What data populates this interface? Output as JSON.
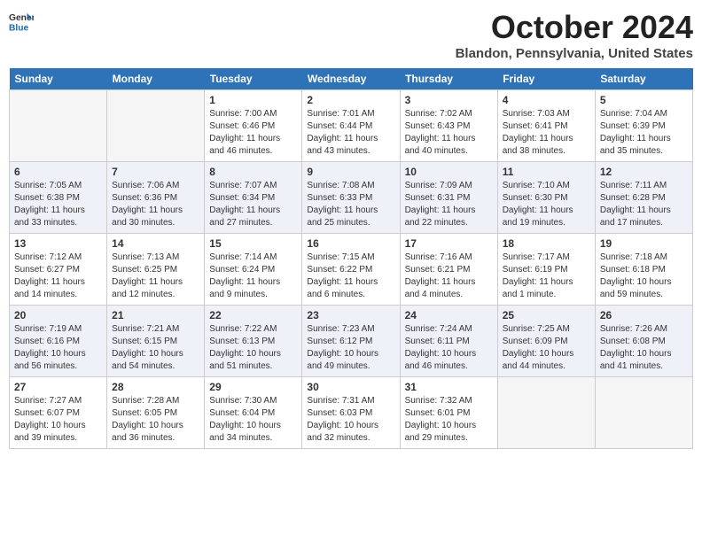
{
  "logo": {
    "general": "General",
    "blue": "Blue"
  },
  "title": "October 2024",
  "location": "Blandon, Pennsylvania, United States",
  "headers": [
    "Sunday",
    "Monday",
    "Tuesday",
    "Wednesday",
    "Thursday",
    "Friday",
    "Saturday"
  ],
  "weeks": [
    [
      {
        "day": "",
        "sunrise": "",
        "sunset": "",
        "daylight": ""
      },
      {
        "day": "",
        "sunrise": "",
        "sunset": "",
        "daylight": ""
      },
      {
        "day": "1",
        "sunrise": "Sunrise: 7:00 AM",
        "sunset": "Sunset: 6:46 PM",
        "daylight": "Daylight: 11 hours and 46 minutes."
      },
      {
        "day": "2",
        "sunrise": "Sunrise: 7:01 AM",
        "sunset": "Sunset: 6:44 PM",
        "daylight": "Daylight: 11 hours and 43 minutes."
      },
      {
        "day": "3",
        "sunrise": "Sunrise: 7:02 AM",
        "sunset": "Sunset: 6:43 PM",
        "daylight": "Daylight: 11 hours and 40 minutes."
      },
      {
        "day": "4",
        "sunrise": "Sunrise: 7:03 AM",
        "sunset": "Sunset: 6:41 PM",
        "daylight": "Daylight: 11 hours and 38 minutes."
      },
      {
        "day": "5",
        "sunrise": "Sunrise: 7:04 AM",
        "sunset": "Sunset: 6:39 PM",
        "daylight": "Daylight: 11 hours and 35 minutes."
      }
    ],
    [
      {
        "day": "6",
        "sunrise": "Sunrise: 7:05 AM",
        "sunset": "Sunset: 6:38 PM",
        "daylight": "Daylight: 11 hours and 33 minutes."
      },
      {
        "day": "7",
        "sunrise": "Sunrise: 7:06 AM",
        "sunset": "Sunset: 6:36 PM",
        "daylight": "Daylight: 11 hours and 30 minutes."
      },
      {
        "day": "8",
        "sunrise": "Sunrise: 7:07 AM",
        "sunset": "Sunset: 6:34 PM",
        "daylight": "Daylight: 11 hours and 27 minutes."
      },
      {
        "day": "9",
        "sunrise": "Sunrise: 7:08 AM",
        "sunset": "Sunset: 6:33 PM",
        "daylight": "Daylight: 11 hours and 25 minutes."
      },
      {
        "day": "10",
        "sunrise": "Sunrise: 7:09 AM",
        "sunset": "Sunset: 6:31 PM",
        "daylight": "Daylight: 11 hours and 22 minutes."
      },
      {
        "day": "11",
        "sunrise": "Sunrise: 7:10 AM",
        "sunset": "Sunset: 6:30 PM",
        "daylight": "Daylight: 11 hours and 19 minutes."
      },
      {
        "day": "12",
        "sunrise": "Sunrise: 7:11 AM",
        "sunset": "Sunset: 6:28 PM",
        "daylight": "Daylight: 11 hours and 17 minutes."
      }
    ],
    [
      {
        "day": "13",
        "sunrise": "Sunrise: 7:12 AM",
        "sunset": "Sunset: 6:27 PM",
        "daylight": "Daylight: 11 hours and 14 minutes."
      },
      {
        "day": "14",
        "sunrise": "Sunrise: 7:13 AM",
        "sunset": "Sunset: 6:25 PM",
        "daylight": "Daylight: 11 hours and 12 minutes."
      },
      {
        "day": "15",
        "sunrise": "Sunrise: 7:14 AM",
        "sunset": "Sunset: 6:24 PM",
        "daylight": "Daylight: 11 hours and 9 minutes."
      },
      {
        "day": "16",
        "sunrise": "Sunrise: 7:15 AM",
        "sunset": "Sunset: 6:22 PM",
        "daylight": "Daylight: 11 hours and 6 minutes."
      },
      {
        "day": "17",
        "sunrise": "Sunrise: 7:16 AM",
        "sunset": "Sunset: 6:21 PM",
        "daylight": "Daylight: 11 hours and 4 minutes."
      },
      {
        "day": "18",
        "sunrise": "Sunrise: 7:17 AM",
        "sunset": "Sunset: 6:19 PM",
        "daylight": "Daylight: 11 hours and 1 minute."
      },
      {
        "day": "19",
        "sunrise": "Sunrise: 7:18 AM",
        "sunset": "Sunset: 6:18 PM",
        "daylight": "Daylight: 10 hours and 59 minutes."
      }
    ],
    [
      {
        "day": "20",
        "sunrise": "Sunrise: 7:19 AM",
        "sunset": "Sunset: 6:16 PM",
        "daylight": "Daylight: 10 hours and 56 minutes."
      },
      {
        "day": "21",
        "sunrise": "Sunrise: 7:21 AM",
        "sunset": "Sunset: 6:15 PM",
        "daylight": "Daylight: 10 hours and 54 minutes."
      },
      {
        "day": "22",
        "sunrise": "Sunrise: 7:22 AM",
        "sunset": "Sunset: 6:13 PM",
        "daylight": "Daylight: 10 hours and 51 minutes."
      },
      {
        "day": "23",
        "sunrise": "Sunrise: 7:23 AM",
        "sunset": "Sunset: 6:12 PM",
        "daylight": "Daylight: 10 hours and 49 minutes."
      },
      {
        "day": "24",
        "sunrise": "Sunrise: 7:24 AM",
        "sunset": "Sunset: 6:11 PM",
        "daylight": "Daylight: 10 hours and 46 minutes."
      },
      {
        "day": "25",
        "sunrise": "Sunrise: 7:25 AM",
        "sunset": "Sunset: 6:09 PM",
        "daylight": "Daylight: 10 hours and 44 minutes."
      },
      {
        "day": "26",
        "sunrise": "Sunrise: 7:26 AM",
        "sunset": "Sunset: 6:08 PM",
        "daylight": "Daylight: 10 hours and 41 minutes."
      }
    ],
    [
      {
        "day": "27",
        "sunrise": "Sunrise: 7:27 AM",
        "sunset": "Sunset: 6:07 PM",
        "daylight": "Daylight: 10 hours and 39 minutes."
      },
      {
        "day": "28",
        "sunrise": "Sunrise: 7:28 AM",
        "sunset": "Sunset: 6:05 PM",
        "daylight": "Daylight: 10 hours and 36 minutes."
      },
      {
        "day": "29",
        "sunrise": "Sunrise: 7:30 AM",
        "sunset": "Sunset: 6:04 PM",
        "daylight": "Daylight: 10 hours and 34 minutes."
      },
      {
        "day": "30",
        "sunrise": "Sunrise: 7:31 AM",
        "sunset": "Sunset: 6:03 PM",
        "daylight": "Daylight: 10 hours and 32 minutes."
      },
      {
        "day": "31",
        "sunrise": "Sunrise: 7:32 AM",
        "sunset": "Sunset: 6:01 PM",
        "daylight": "Daylight: 10 hours and 29 minutes."
      },
      {
        "day": "",
        "sunrise": "",
        "sunset": "",
        "daylight": ""
      },
      {
        "day": "",
        "sunrise": "",
        "sunset": "",
        "daylight": ""
      }
    ]
  ]
}
